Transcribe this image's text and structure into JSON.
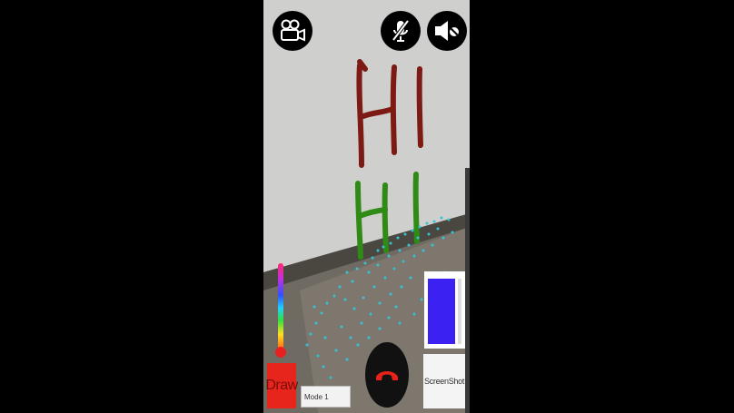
{
  "toolbar": {
    "video_icon": "video-camera-icon",
    "mic_icon": "mic-muted-icon",
    "speaker_icon": "speaker-muted-icon"
  },
  "controls": {
    "draw_label": "Draw",
    "draw_color": "#e8251c",
    "mode_value": "Mode 1",
    "screenshot_label": "ScreenShot",
    "end_call_icon": "phone-hangup-icon",
    "preview_color": "#3b22f2"
  },
  "annotations": {
    "red_text": "HI",
    "green_text": "HI",
    "red_color": "#7e1a14",
    "green_color": "#2f8a16"
  }
}
